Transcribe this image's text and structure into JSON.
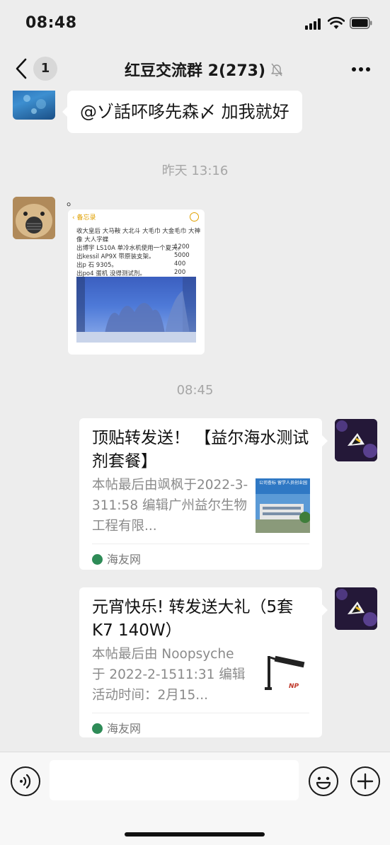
{
  "status_bar": {
    "time": "08:48"
  },
  "nav": {
    "unread_count": "1",
    "title": "红豆交流群 2(273)"
  },
  "messages": {
    "first_text": "@ゾ話吥哆先森〆 加我就好",
    "timestamp_1": "昨天 13:16",
    "dot_text": "。",
    "image": {
      "back_label": "备忘录",
      "lines": [
        "收大皇后 大马鞍 大北斗 大毛巾 大金毛巾 大神",
        "像 大人字蝶",
        "出博宇 LS10A 单冷水机使用一个夏天。",
        "出kessil AP9X 带原装支架。",
        "出p 石 9305。",
        "出po4 蛋机 没得测试剂。"
      ],
      "prices": [
        "1200",
        "5000",
        "400",
        "200"
      ]
    },
    "timestamp_2": "08:45",
    "cards": [
      {
        "title": "顶贴转发送！ 【益尔海水测试剂套餐】",
        "desc": "本帖最后由飒枫于2022-3-311:58 编辑广州益尔生物工程有限...",
        "source": "海友网",
        "thumb_text": "公司查标 留学人员创业园"
      },
      {
        "title": "元宵快乐! 转发送大礼（5套 K7  140W）",
        "desc": "本帖最后由 Noopsyche 于 2022-2-1511:31 编辑活动时间：2月15...",
        "source": "海友网",
        "thumb_text": "NP"
      }
    ]
  },
  "colors": {
    "background": "#ededed",
    "bubble": "#ffffff",
    "source_icon": "#2e8b57"
  },
  "icons": [
    "back-chevron-icon",
    "mute-bell-icon",
    "more-dots-icon",
    "voice-icon",
    "emoji-icon",
    "plus-icon"
  ]
}
